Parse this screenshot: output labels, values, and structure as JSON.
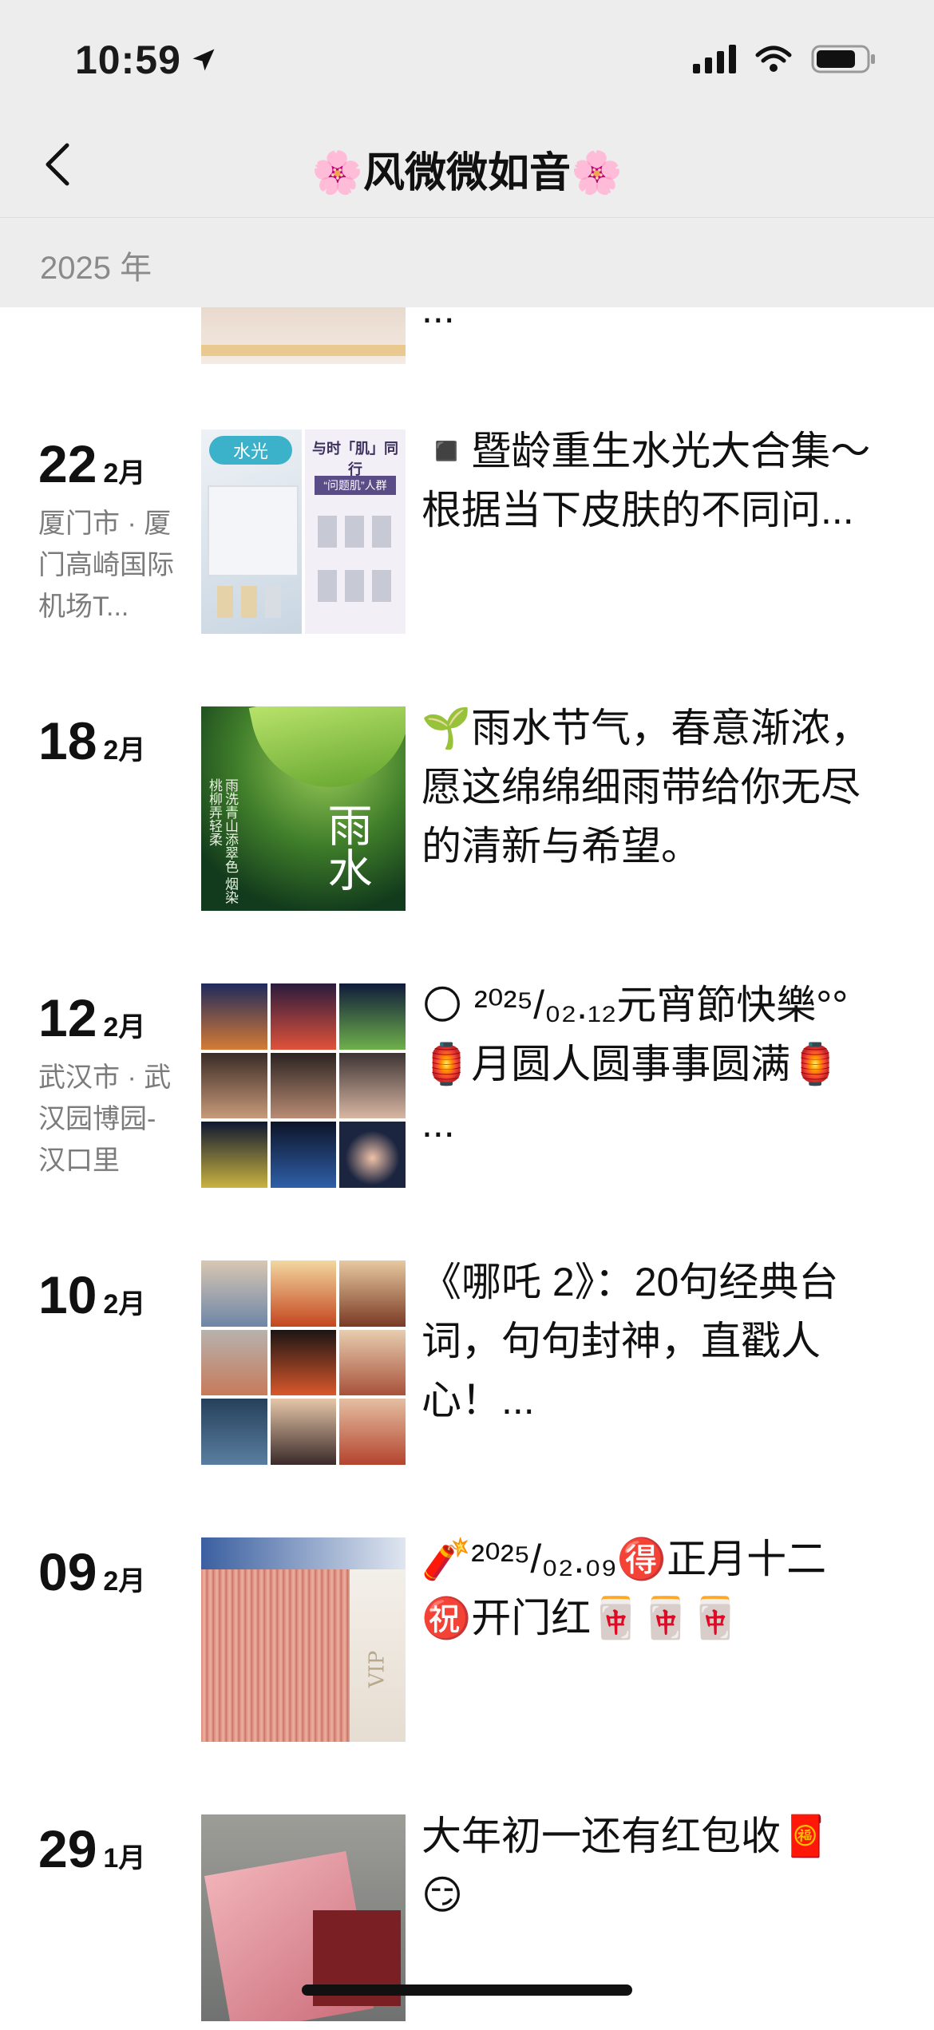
{
  "status_bar": {
    "time": "10:59"
  },
  "nav": {
    "title": "🌸风微微如音🌸"
  },
  "year_header": "2025 年",
  "partial_top_caption": "...",
  "entries": [
    {
      "day": "22",
      "month": "2月",
      "location": "厦门市 · 厦门高崎国际机场T...",
      "caption": "◾️暨龄重生水光大合集～\n根据当下皮肤的不同问..."
    },
    {
      "day": "18",
      "month": "2月",
      "location": "",
      "caption": "🌱雨水节气，春意渐浓，愿这绵绵细雨带给你无尽的清新与希望。"
    },
    {
      "day": "12",
      "month": "2月",
      "location": "武汉市 · 武汉园博园-汉口里",
      "caption": "🌕 ²⁰²⁵/₀₂.₁₂元宵節快樂°°\n🏮月圆人圆事事圆满🏮\n..."
    },
    {
      "day": "10",
      "month": "2月",
      "location": "",
      "caption": "《哪吒 2》：20句经典台词，句句封神，直戳人心！..."
    },
    {
      "day": "09",
      "month": "2月",
      "location": "",
      "caption": "🧨²⁰²⁵/₀₂.₀₉🉐正月十二\n㊗️开门红🀄🀄🀄"
    },
    {
      "day": "29",
      "month": "1月",
      "location": "",
      "caption": "大年初一还有红包收🧧\n😏"
    }
  ],
  "thumb_text": {
    "skin_left": "水光",
    "skin_right_title": "与时「肌」同行",
    "skin_right_badge": "“问题肌”人群",
    "rain_vertical": "雨洗青山添翠色 烟染桃柳弄轻柔",
    "rain_big": "雨水",
    "cash_label": "VIP"
  }
}
